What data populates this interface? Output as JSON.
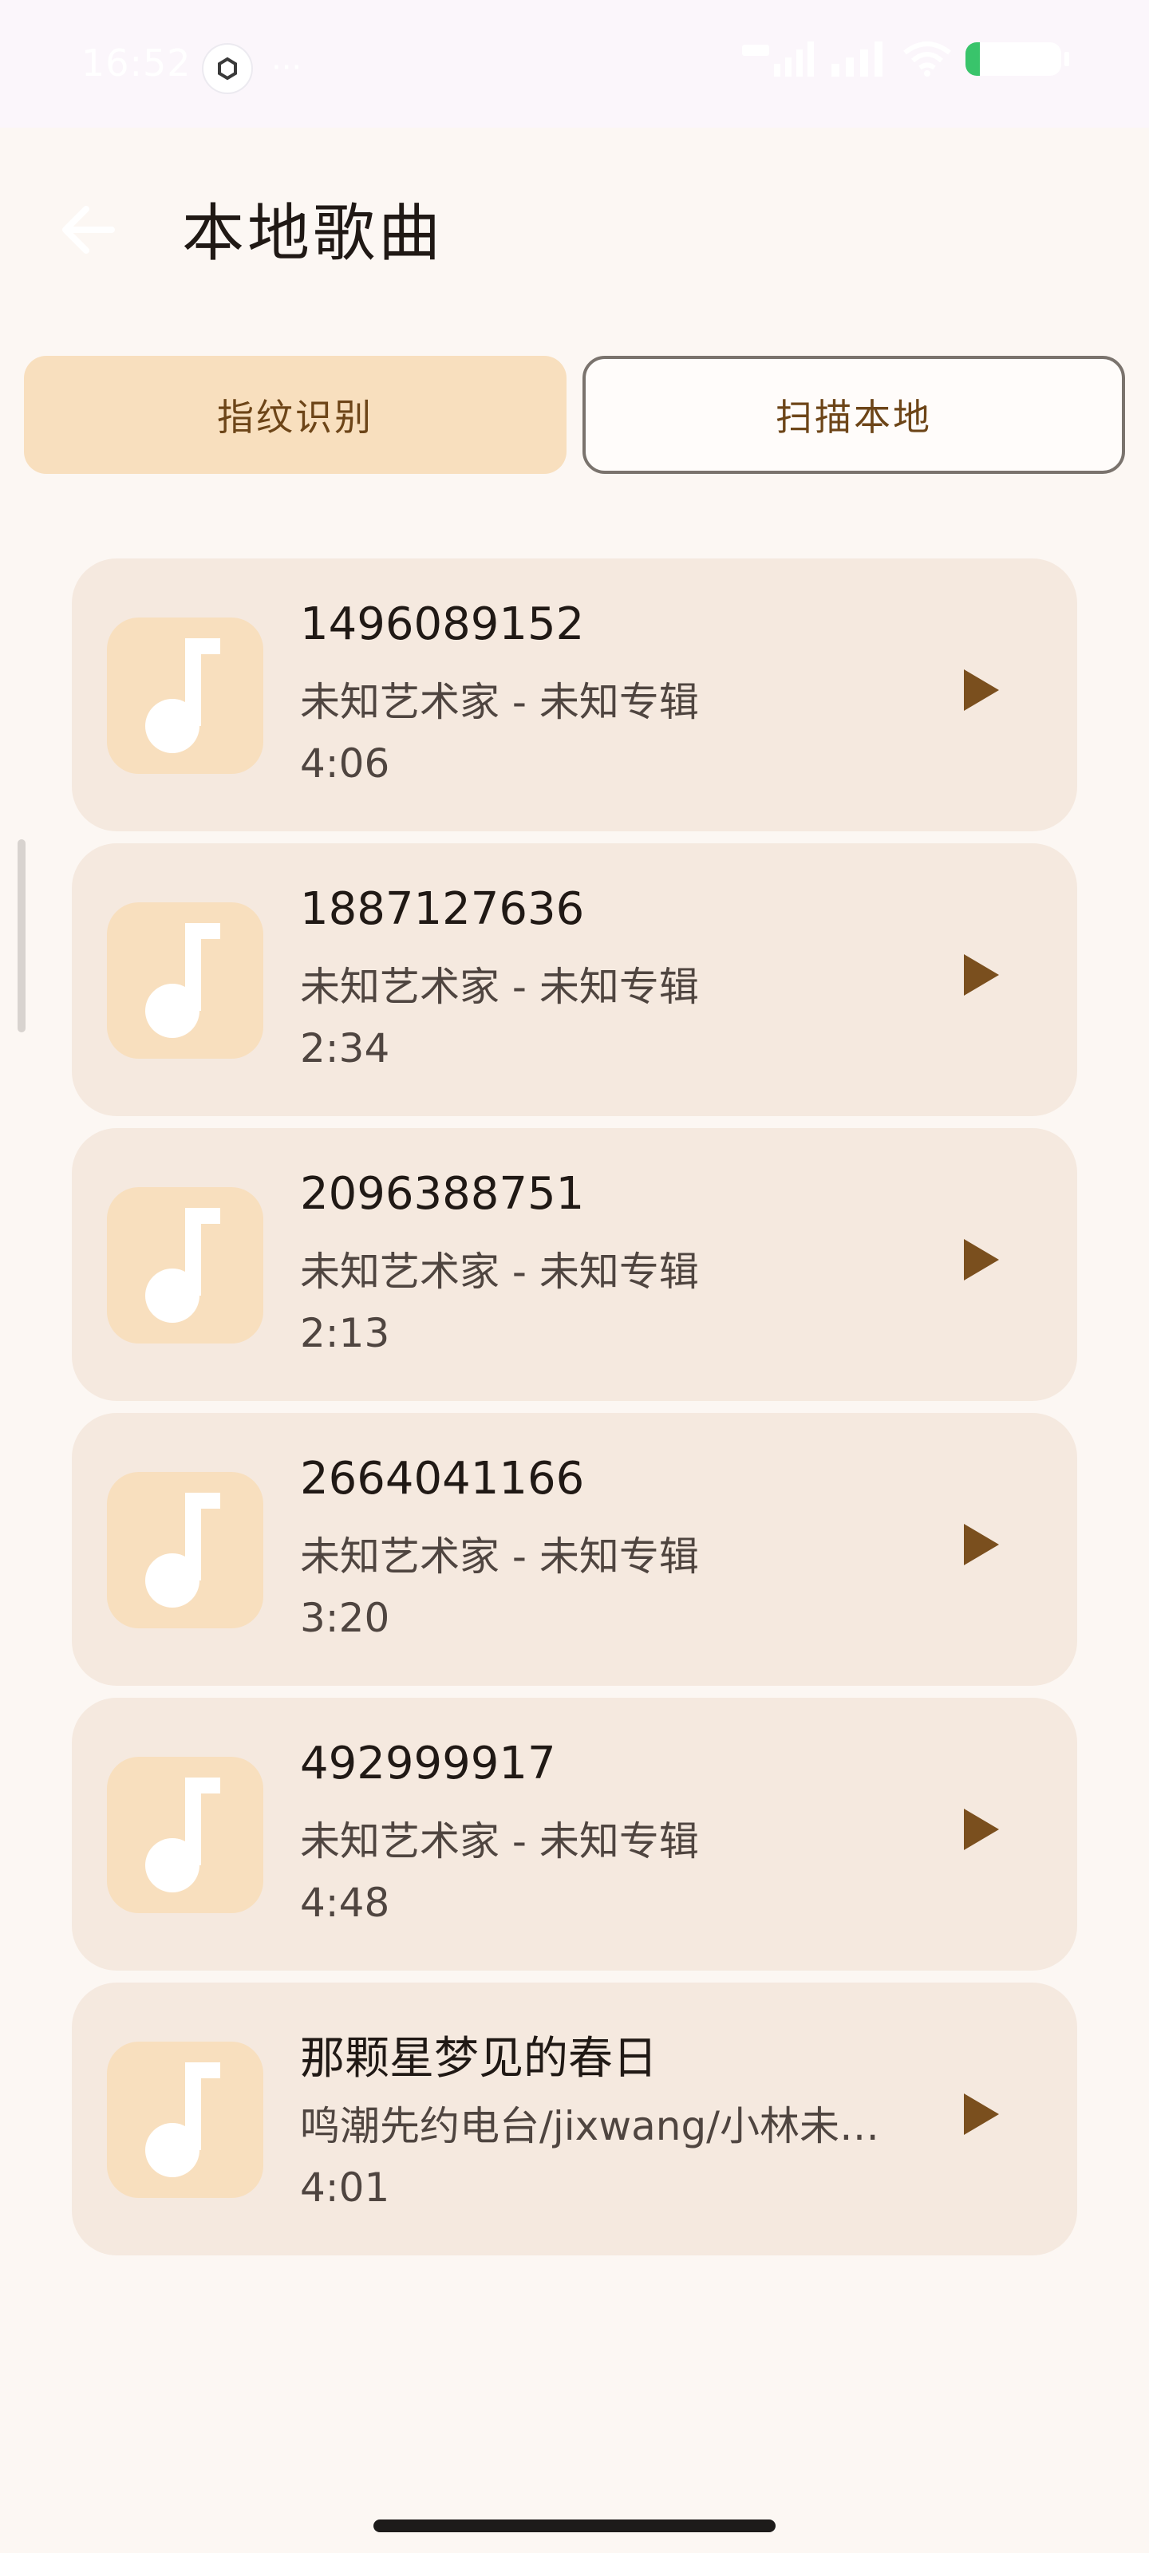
{
  "status_bar": {
    "time": "16:52",
    "more": "···",
    "icons": [
      "app-notification-icon",
      "signal-icon",
      "signal-icon",
      "wifi-icon",
      "battery-icon"
    ]
  },
  "app_bar": {
    "title": "本地歌曲",
    "back_icon": "arrow-left-icon"
  },
  "tabs": [
    {
      "label": "指纹识别",
      "selected": true
    },
    {
      "label": "扫描本地",
      "selected": false
    }
  ],
  "songs": [
    {
      "title": "1496089152",
      "artist": "未知艺术家 - 未知专辑",
      "duration": "4:06"
    },
    {
      "title": "1887127636",
      "artist": "未知艺术家 - 未知专辑",
      "duration": "2:34"
    },
    {
      "title": "2096388751",
      "artist": "未知艺术家 - 未知专辑",
      "duration": "2:13"
    },
    {
      "title": "2664041166",
      "artist": "未知艺术家 - 未知专辑",
      "duration": "3:20"
    },
    {
      "title": "492999917",
      "artist": "未知艺术家 - 未知专辑",
      "duration": "4:48"
    },
    {
      "title": "那颗星梦见的春日",
      "artist": "鸣潮先约电台/jixwang/小林未…",
      "duration": "4:01"
    }
  ],
  "colors": {
    "background": "#fcf7f3",
    "card": "#f5e9df",
    "accent_fill": "#f8dfbe",
    "accent_text": "#6d4518",
    "play_icon": "#7a4f1e"
  }
}
